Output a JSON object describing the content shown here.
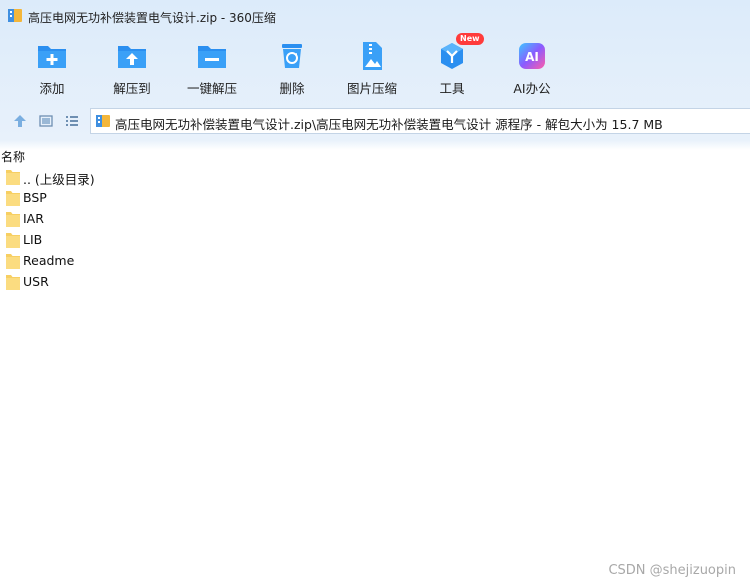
{
  "window": {
    "title": "高压电网无功补偿装置电气设计.zip - 360压缩"
  },
  "toolbar": {
    "items": [
      {
        "id": "add",
        "label": "添加",
        "icon": "add-folder-icon"
      },
      {
        "id": "extract-to",
        "label": "解压到",
        "icon": "extract-folder-icon"
      },
      {
        "id": "one-click-extract",
        "label": "一键解压",
        "icon": "one-click-extract-icon"
      },
      {
        "id": "delete",
        "label": "删除",
        "icon": "recycle-bin-icon"
      },
      {
        "id": "image-compress",
        "label": "图片压缩",
        "icon": "image-compress-icon"
      },
      {
        "id": "tools",
        "label": "工具",
        "icon": "tools-cube-icon",
        "badge": "New"
      },
      {
        "id": "ai-office",
        "label": "AI办公",
        "icon": "ai-icon",
        "icon_text": "AI"
      }
    ]
  },
  "address": {
    "path": "高压电网无功补偿装置电气设计.zip\\高压电网无功补偿装置电气设计 源程序 - 解包大小为 15.7 MB"
  },
  "list": {
    "column_header": "名称",
    "items": [
      {
        "name": ".. (上级目录)"
      },
      {
        "name": "BSP"
      },
      {
        "name": "IAR"
      },
      {
        "name": "LIB"
      },
      {
        "name": "Readme"
      },
      {
        "name": "USR"
      }
    ]
  },
  "watermark": "CSDN @shejizuopin",
  "colors": {
    "accent_blue": "#2b8ff0",
    "folder_yellow": "#f7cf62",
    "badge_red": "#ff3b3b"
  }
}
